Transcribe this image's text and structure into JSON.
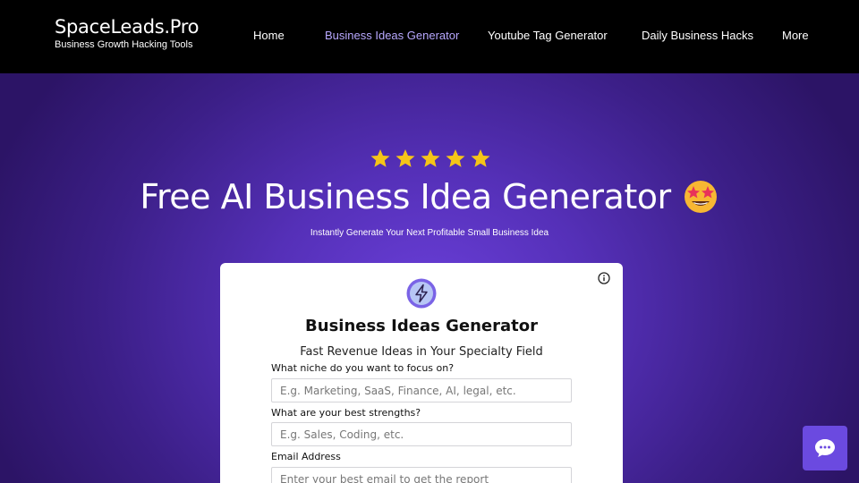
{
  "header": {
    "brand_title": "SpaceLeads.Pro",
    "brand_subtitle": "Business Growth Hacking Tools",
    "nav": [
      {
        "label": "Home"
      },
      {
        "label": "Business Ideas Generator",
        "active": true
      },
      {
        "label": "Youtube Tag Generator"
      },
      {
        "label": "Daily Business Hacks"
      },
      {
        "label": "More"
      }
    ]
  },
  "hero": {
    "rating_stars": 5,
    "title": "Free AI Business Idea Generator",
    "emoji": "star-struck-emoji",
    "subtitle": "Instantly Generate Your Next Profitable Small Business Idea"
  },
  "card": {
    "icon": "lightning-bolt-icon",
    "title": "Business Ideas Generator",
    "subtitle": "Fast Revenue Ideas in Your Specialty Field",
    "fields": [
      {
        "label": "What niche do you want to focus on?",
        "placeholder": "E.g. Marketing, SaaS, Finance, AI, legal, etc.",
        "value": ""
      },
      {
        "label": "What are your best strengths?",
        "placeholder": "E.g. Sales, Coding, etc.",
        "value": ""
      },
      {
        "label": "Email Address",
        "placeholder": "Enter your best email to get the report",
        "value": ""
      }
    ]
  },
  "chat": {
    "icon": "chat-bubble-icon"
  },
  "colors": {
    "accent": "#6b4ae0",
    "active_nav": "#b8a8ff",
    "star": "#f5c518"
  }
}
